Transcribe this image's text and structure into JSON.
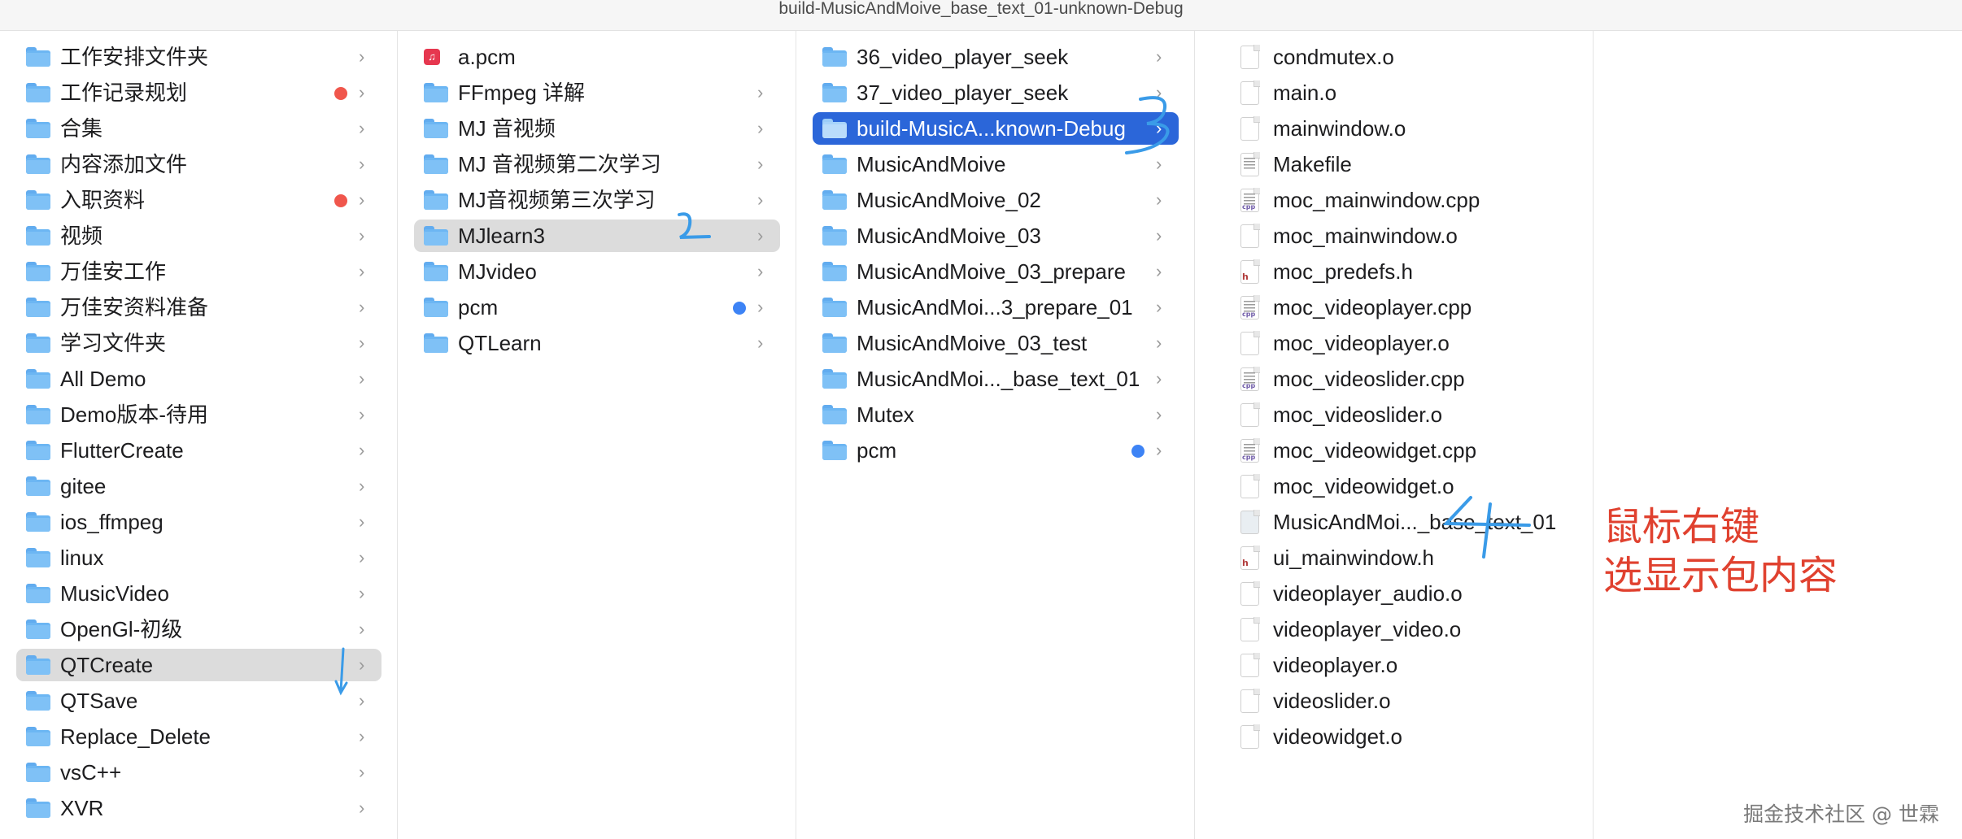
{
  "window": {
    "title": "build-MusicAndMoive_base_text_01-unknown-Debug"
  },
  "columns": [
    {
      "items": [
        {
          "label": "工作安排文件夹",
          "type": "folder"
        },
        {
          "label": "工作记录规划",
          "type": "folder",
          "tag": "red"
        },
        {
          "label": "合集",
          "type": "folder"
        },
        {
          "label": "内容添加文件",
          "type": "folder"
        },
        {
          "label": "入职资料",
          "type": "folder",
          "tag": "red"
        },
        {
          "label": "视频",
          "type": "folder"
        },
        {
          "label": "万佳安工作",
          "type": "folder"
        },
        {
          "label": "万佳安资料准备",
          "type": "folder"
        },
        {
          "label": "学习文件夹",
          "type": "folder"
        },
        {
          "label": "All Demo",
          "type": "folder"
        },
        {
          "label": "Demo版本-待用",
          "type": "folder"
        },
        {
          "label": "FlutterCreate",
          "type": "folder"
        },
        {
          "label": "gitee",
          "type": "folder"
        },
        {
          "label": "ios_ffmpeg",
          "type": "folder"
        },
        {
          "label": "linux",
          "type": "folder"
        },
        {
          "label": "MusicVideo",
          "type": "folder"
        },
        {
          "label": "OpenGl-初级",
          "type": "folder"
        },
        {
          "label": "QTCreate",
          "type": "folder",
          "selected": true
        },
        {
          "label": "QTSave",
          "type": "folder"
        },
        {
          "label": "Replace_Delete",
          "type": "folder"
        },
        {
          "label": "vsC++",
          "type": "folder"
        },
        {
          "label": "XVR",
          "type": "folder"
        }
      ]
    },
    {
      "items": [
        {
          "label": "a.pcm",
          "type": "audio",
          "glyph": "♫"
        },
        {
          "label": "FFmpeg 详解",
          "type": "folder"
        },
        {
          "label": "MJ 音视频",
          "type": "folder"
        },
        {
          "label": "MJ 音视频第二次学习",
          "type": "folder"
        },
        {
          "label": "MJ音视频第三次学习",
          "type": "folder"
        },
        {
          "label": "MJlearn3",
          "type": "folder",
          "selected": true
        },
        {
          "label": "MJvideo",
          "type": "folder"
        },
        {
          "label": "pcm",
          "type": "folder",
          "tag": "blue"
        },
        {
          "label": "QTLearn",
          "type": "folder"
        }
      ]
    },
    {
      "items": [
        {
          "label": "36_video_player_seek",
          "type": "folder"
        },
        {
          "label": "37_video_player_seek",
          "type": "folder"
        },
        {
          "label": "build-MusicA...known-Debug",
          "type": "folder",
          "active": true
        },
        {
          "label": "MusicAndMoive",
          "type": "folder"
        },
        {
          "label": "MusicAndMoive_02",
          "type": "folder"
        },
        {
          "label": "MusicAndMoive_03",
          "type": "folder"
        },
        {
          "label": "MusicAndMoive_03_prepare",
          "type": "folder"
        },
        {
          "label": "MusicAndMoi...3_prepare_01",
          "type": "folder"
        },
        {
          "label": "MusicAndMoive_03_test",
          "type": "folder"
        },
        {
          "label": "MusicAndMoi..._base_text_01",
          "type": "folder"
        },
        {
          "label": "Mutex",
          "type": "folder"
        },
        {
          "label": "pcm",
          "type": "folder",
          "tag": "blue"
        }
      ]
    },
    {
      "items": [
        {
          "label": "condmutex.o",
          "type": "doc"
        },
        {
          "label": "main.o",
          "type": "doc"
        },
        {
          "label": "mainwindow.o",
          "type": "doc"
        },
        {
          "label": "Makefile",
          "type": "text"
        },
        {
          "label": "moc_mainwindow.cpp",
          "type": "cpp",
          "ext": "cpp"
        },
        {
          "label": "moc_mainwindow.o",
          "type": "doc"
        },
        {
          "label": "moc_predefs.h",
          "type": "h",
          "ext": "h"
        },
        {
          "label": "moc_videoplayer.cpp",
          "type": "cpp",
          "ext": "cpp"
        },
        {
          "label": "moc_videoplayer.o",
          "type": "doc"
        },
        {
          "label": "moc_videoslider.cpp",
          "type": "cpp",
          "ext": "cpp"
        },
        {
          "label": "moc_videoslider.o",
          "type": "doc"
        },
        {
          "label": "moc_videowidget.cpp",
          "type": "cpp",
          "ext": "cpp"
        },
        {
          "label": "moc_videowidget.o",
          "type": "doc"
        },
        {
          "label": "MusicAndMoi..._base_text_01",
          "type": "exec"
        },
        {
          "label": "ui_mainwindow.h",
          "type": "h",
          "ext": "h"
        },
        {
          "label": "videoplayer_audio.o",
          "type": "doc"
        },
        {
          "label": "videoplayer_video.o",
          "type": "doc"
        },
        {
          "label": "videoplayer.o",
          "type": "doc"
        },
        {
          "label": "videoslider.o",
          "type": "doc"
        },
        {
          "label": "videowidget.o",
          "type": "doc"
        }
      ]
    },
    {
      "items": []
    }
  ],
  "annotation": {
    "line1": "鼠标右键",
    "line2": "选显示包内容"
  },
  "watermark": "掘金技术社区 @ 世霖",
  "chevron": "›",
  "colors": {
    "selection": "#dcdcdc",
    "active": "#2b66d9",
    "annotation": "#e0412f",
    "scribble": "#3a9be8"
  }
}
